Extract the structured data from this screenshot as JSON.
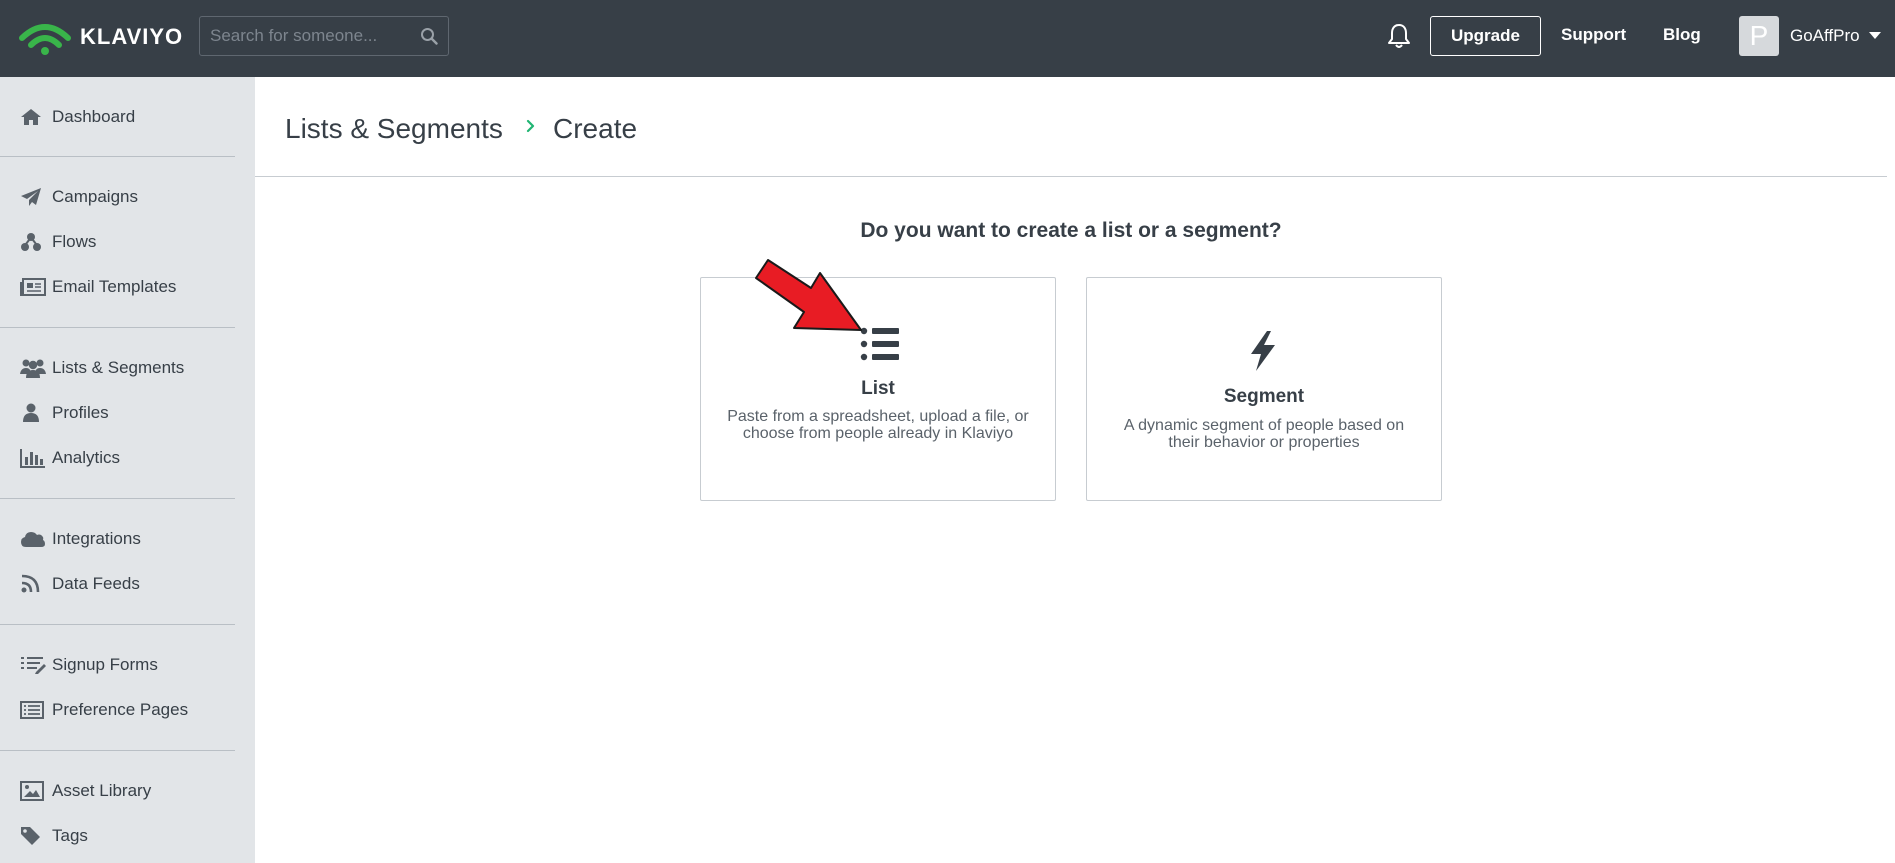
{
  "app": {
    "brand": "KLAVIYO",
    "brand_color": "#39b54a",
    "accent_color": "#21b573"
  },
  "topbar": {
    "search_placeholder": "Search for someone...",
    "bell_icon": "bell-icon",
    "upgrade_label": "Upgrade",
    "support_label": "Support",
    "blog_label": "Blog",
    "avatar_initial": "P",
    "account_name": "GoAffPro"
  },
  "sidebar": {
    "items": [
      {
        "label": "Dashboard",
        "icon": "home-icon"
      },
      {
        "label": "Campaigns",
        "icon": "paper-plane-icon"
      },
      {
        "label": "Flows",
        "icon": "flows-icon"
      },
      {
        "label": "Email Templates",
        "icon": "newspaper-icon"
      },
      {
        "label": "Lists & Segments",
        "icon": "users-icon"
      },
      {
        "label": "Profiles",
        "icon": "user-icon"
      },
      {
        "label": "Analytics",
        "icon": "bar-chart-icon"
      },
      {
        "label": "Integrations",
        "icon": "cloud-icon"
      },
      {
        "label": "Data Feeds",
        "icon": "rss-icon"
      },
      {
        "label": "Signup Forms",
        "icon": "form-list-icon"
      },
      {
        "label": "Preference Pages",
        "icon": "list-alt-icon"
      },
      {
        "label": "Asset Library",
        "icon": "image-icon"
      },
      {
        "label": "Tags",
        "icon": "tag-icon"
      }
    ]
  },
  "breadcrumb": {
    "parent": "Lists & Segments",
    "current": "Create"
  },
  "main": {
    "question": "Do you want to create a list or a segment?",
    "cards": [
      {
        "title": "List",
        "description": "Paste from a spreadsheet, upload a file, or choose from people already in Klaviyo",
        "icon": "list-icon"
      },
      {
        "title": "Segment",
        "description": "A dynamic segment of people based on their behavior or properties",
        "icon": "bolt-icon"
      }
    ]
  },
  "annotation": {
    "icon": "red-arrow-icon",
    "color": "#e81c24"
  }
}
